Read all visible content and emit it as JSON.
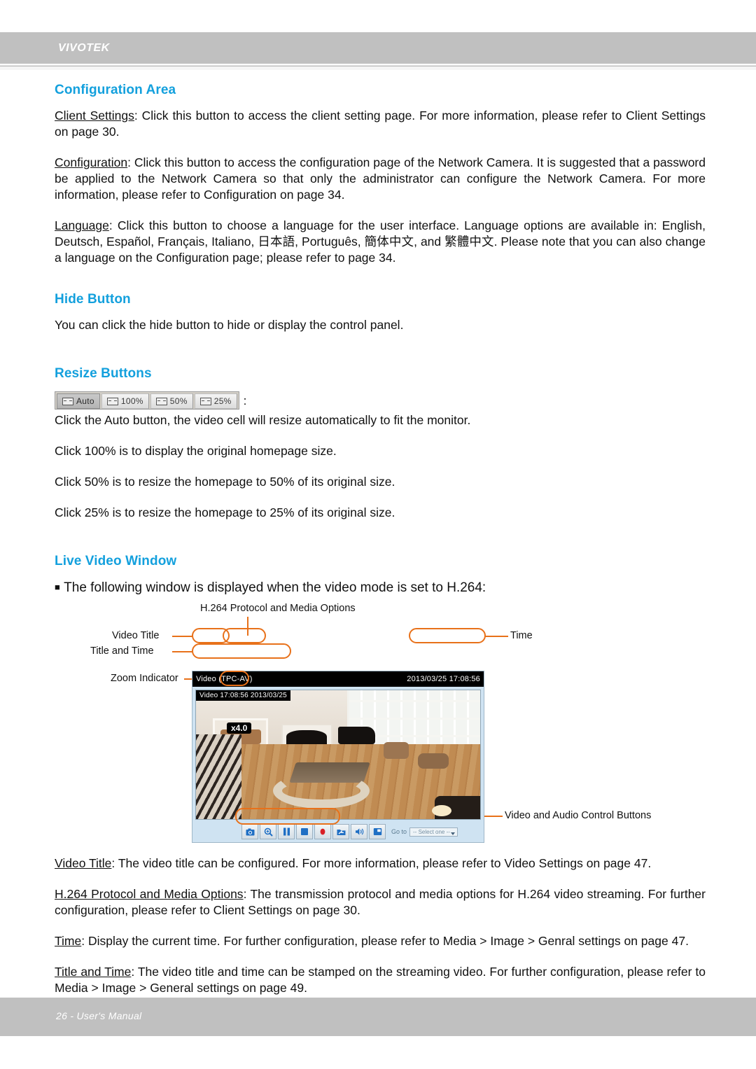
{
  "header": {
    "brand": "VIVOTEK"
  },
  "footer": {
    "text": "26 - User's Manual"
  },
  "sections": {
    "configuration_area": {
      "heading": "Configuration Area",
      "p1_term": "Client Settings",
      "p1_rest": ": Click this button to access the client setting page. For more information, please refer to Client Settings on page 30.",
      "p2_term": "Configuration",
      "p2_rest": ": Click this button to access the configuration page of the Network Camera. It is suggested that a password be applied to the Network Camera so that only the administrator can configure the Network Camera. For more information, please refer to Configuration on page 34.",
      "p3_term": "Language",
      "p3_rest": ": Click this button to choose a language for the user interface. Language options are available in: English, Deutsch, Español, Français, Italiano, 日本語, Português, 簡体中文, and 繁體中文.  Please note that you can also change a language on the Configuration page; please refer to page 34."
    },
    "hide_button": {
      "heading": "Hide Button",
      "text": "You can click the hide button to hide or display the control panel."
    },
    "resize_buttons": {
      "heading": "Resize Buttons",
      "toolbar": [
        {
          "label": "Auto",
          "pressed": true
        },
        {
          "label": "100%",
          "pressed": false
        },
        {
          "label": "50%",
          "pressed": false
        },
        {
          "label": "25%",
          "pressed": false
        }
      ],
      "colon": ":",
      "lines": [
        "Click the Auto button, the video cell will resize automatically to fit the monitor.",
        "Click 100% is to display the original homepage size.",
        "Click 50% is to resize the homepage to 50% of its original size.",
        "Click 25% is to resize the homepage to 25% of its original size."
      ]
    },
    "live_video_window": {
      "heading": "Live Video Window",
      "bullet": "■",
      "intro": "The following window is displayed when the video mode is set to H.264:",
      "callouts": {
        "protocol": "H.264 Protocol and Media Options",
        "video_title": "Video Title",
        "title_and_time": "Title and Time",
        "zoom_indicator": "Zoom Indicator",
        "time": "Time",
        "controls": "Video and Audio Control Buttons"
      },
      "player": {
        "titlebar_left": "Video (TPC-AV)",
        "titlebar_right": "2013/03/25  17:08:56",
        "osd_title_time": "Video 17:08:56  2013/03/25",
        "osd_zoom": "x4.0",
        "goto_label": "Go to",
        "select_placeholder": "-- Select one --",
        "buttons": [
          "snapshot-icon",
          "digital-zoom-icon",
          "pause-icon",
          "stop-icon",
          "record-icon",
          "save-folder-icon",
          "volume-icon",
          "fullscreen-icon"
        ]
      }
    },
    "definitions": {
      "d1_term": "Video Title",
      "d1_rest": ": The video title can be configured. For more information, please refer to Video Settings on page 47.",
      "d2_term": "H.264 Protocol and Media Options",
      "d2_rest": ": The transmission protocol and media options for H.264 video streaming. For further configuration, please refer to Client Settings on page 30.",
      "d3_term": "Time",
      "d3_rest": ": Display the current time. For further configuration, please refer to Media > Image > Genral settings on page 47.",
      "d4_term": "Title and Time",
      "d4_rest": ": The video title and time can be stamped on the streaming video. For further configuration, please refer to Media > Image > General settings on page 49."
    }
  },
  "colors": {
    "heading_blue": "#13a0dd",
    "band_gray": "#c0c0c0",
    "callout_orange": "#e8711a"
  }
}
